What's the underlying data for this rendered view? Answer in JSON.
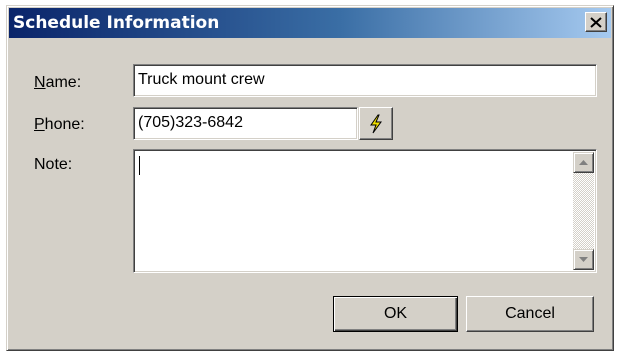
{
  "dialog": {
    "title": "Schedule Information",
    "close_icon": "close-icon"
  },
  "form": {
    "name_label_prefix": "",
    "name_label_accel": "N",
    "name_label_rest": "ame:",
    "name_value": "Truck mount crew",
    "phone_label_accel": "P",
    "phone_label_rest": "hone:",
    "phone_value": "(705)323-6842",
    "dial_icon": "lightning-dial-icon",
    "note_label": "Note:",
    "note_value": ""
  },
  "buttons": {
    "ok_label": "OK",
    "cancel_label": "Cancel"
  }
}
